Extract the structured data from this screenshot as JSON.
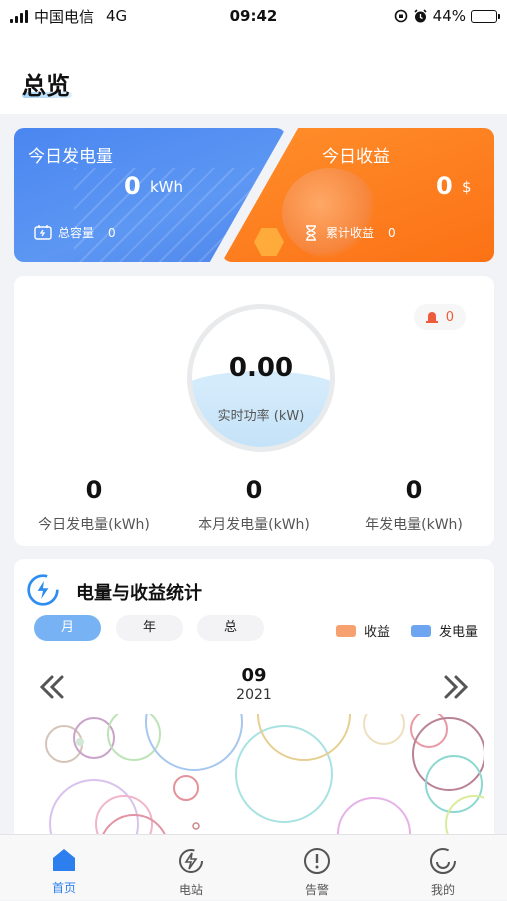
{
  "status_bar": {
    "carrier": "中国电信",
    "network": "4G",
    "time": "09:42",
    "battery": "44%",
    "battery_level": 0.44
  },
  "header": {
    "title": "总览"
  },
  "summary": {
    "generation": {
      "label": "今日发电量",
      "value": "0",
      "unit": "kWh",
      "footer_label": "总容量",
      "footer_value": "0"
    },
    "income": {
      "label": "今日收益",
      "value": "0",
      "unit": "$",
      "footer_label": "累计收益",
      "footer_value": "0"
    }
  },
  "power_panel": {
    "alarm_count": "0",
    "realtime_value": "0.00",
    "realtime_label": "实时功率 (kW)",
    "stats": [
      {
        "value": "0",
        "label": "今日发电量(kWh)"
      },
      {
        "value": "0",
        "label": "本月发电量(kWh)"
      },
      {
        "value": "0",
        "label": "年发电量(kWh)"
      }
    ]
  },
  "statistics": {
    "title": "电量与收益统计",
    "tabs": [
      "月",
      "年",
      "总"
    ],
    "active_tab": "月",
    "legend": [
      {
        "name": "收益",
        "color": "#f7a070"
      },
      {
        "name": "发电量",
        "color": "#6ea5f1"
      }
    ],
    "month": "09",
    "year": "2021",
    "prev_icon": "double-chevron-left-icon",
    "next_icon": "double-chevron-right-icon"
  },
  "tab_bar": {
    "items": [
      {
        "label": "首页",
        "icon": "home-icon"
      },
      {
        "label": "电站",
        "icon": "station-icon"
      },
      {
        "label": "告警",
        "icon": "alert-icon"
      },
      {
        "label": "我的",
        "icon": "profile-icon"
      }
    ],
    "active": "首页"
  },
  "colors": {
    "accent": "#2d7ff0",
    "card_blue": "#4a86f0",
    "card_orange": "#fd7a1c",
    "alarm": "#ee5a3c"
  }
}
